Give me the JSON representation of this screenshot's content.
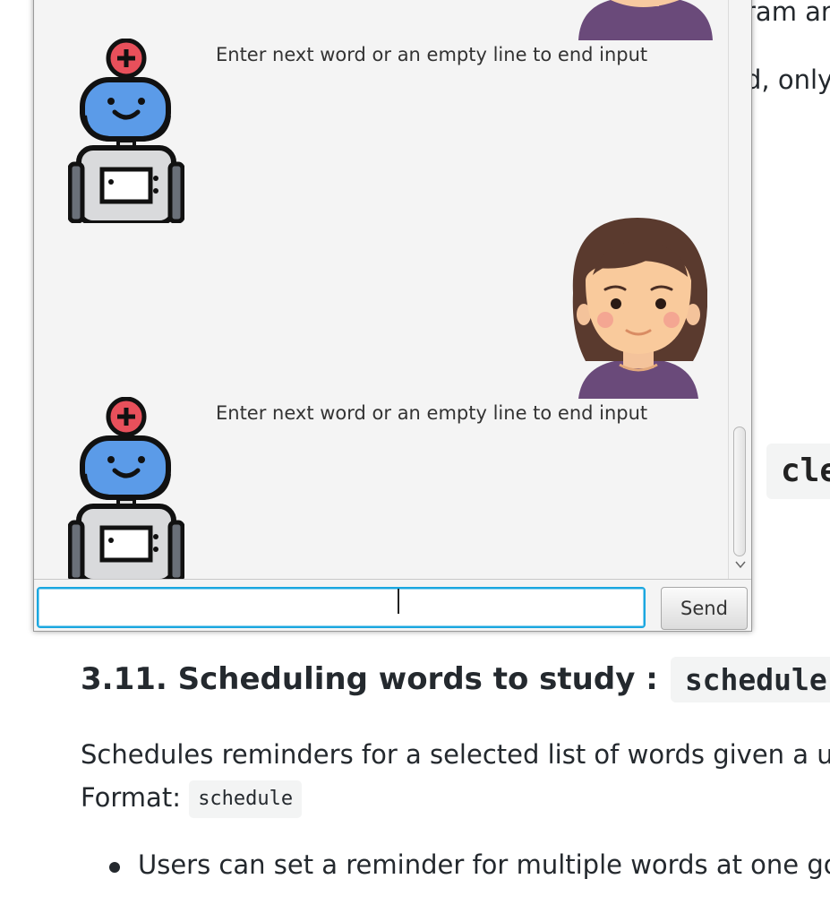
{
  "background_doc": {
    "frag_top": "ram an",
    "frag_mid": "d, only",
    "frag_chip": "cle",
    "frag_chip_prefix": ":",
    "heading": {
      "title": "3.11. Scheduling words to study :",
      "command": "schedule"
    },
    "paragraph": {
      "line1": "Schedules reminders for a selected list of words given a use",
      "format_label": "Format:",
      "format_code": "schedule"
    },
    "bullets": [
      "Users can set a reminder for multiple words at one go."
    ]
  },
  "chat": {
    "messages": [
      {
        "sender": "bot",
        "text": "Enter next word or an empty line to end input"
      },
      {
        "sender": "bot",
        "text": "Enter next word or an empty line to end input"
      }
    ],
    "input": {
      "value": "",
      "placeholder": ""
    },
    "send_label": "Send",
    "icons": {
      "bot_avatar": "robot-icon",
      "user_avatar": "girl-avatar-icon",
      "scroll_down": "chevron-down-icon"
    },
    "colors": {
      "focus_border": "#1aa7e0",
      "robot_head": "#5b9be8",
      "robot_antenna": "#e8505b",
      "user_shirt": "#6a4a7a",
      "user_hair": "#5a3a2e"
    }
  }
}
